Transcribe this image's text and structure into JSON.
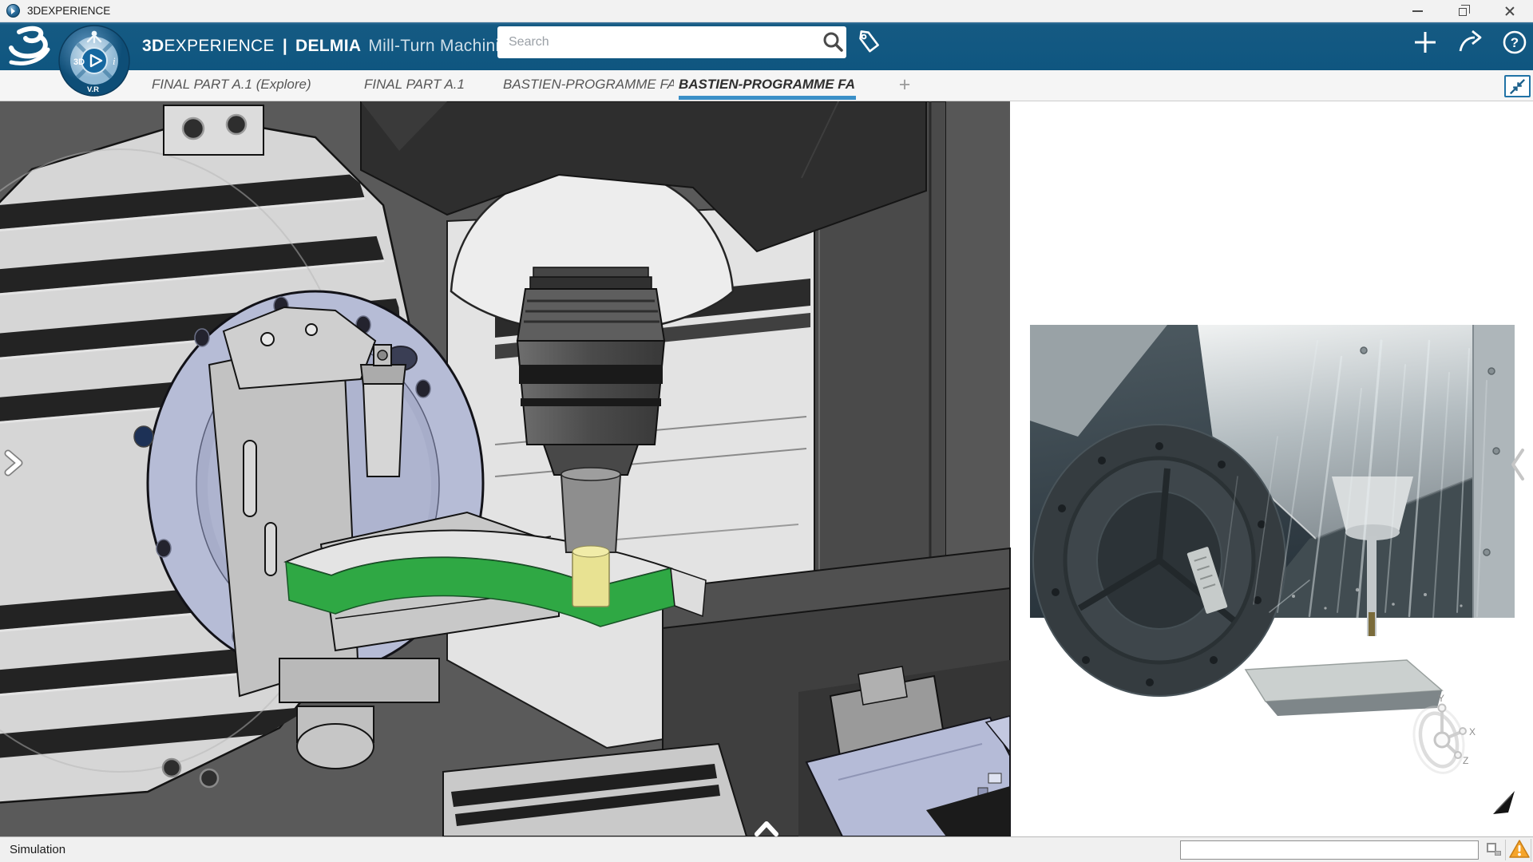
{
  "window": {
    "title": "3DEXPERIENCE"
  },
  "header": {
    "brand_bold": "3D",
    "brand_rest": "EXPERIENCE",
    "separator": "|",
    "app_name": "DELMIA",
    "module_name": "Mill-Turn Machining",
    "search_placeholder": "Search",
    "compass": {
      "left": "3D",
      "right": "i",
      "bottom": "V.R"
    },
    "icons": [
      "tag-icon",
      "add-icon",
      "share-icon",
      "help-icon"
    ]
  },
  "tabs": {
    "items": [
      {
        "label": "FINAL PART A.1 (Explore)",
        "active": false
      },
      {
        "label": "FINAL PART A.1",
        "active": false
      },
      {
        "label": "BASTIEN-PROGRAMME FAO",
        "active": false
      },
      {
        "label": "BASTIEN-PROGRAMME FA",
        "active": true
      }
    ],
    "add": "+"
  },
  "viewport": {
    "axes": {
      "x": "X",
      "y": "Y",
      "z": "Z"
    },
    "scene": "CNC mill-turn machine simulation: rotary table with lavender chuck, gray fixture, green machined part, yellow tool in spindle",
    "inset": "live machining video with coolant spray"
  },
  "statusbar": {
    "mode_label": "Simulation",
    "command_value": ""
  },
  "colors": {
    "header_blue": "#0F5680",
    "tab_underline": "#3A8FC7",
    "scene_background": "#5A5A5A",
    "part_green": "#2FA844",
    "tool_yellow": "#E8E292",
    "fixture_lavender": "#B6BCD6",
    "warning_orange": "#F5A42A"
  }
}
